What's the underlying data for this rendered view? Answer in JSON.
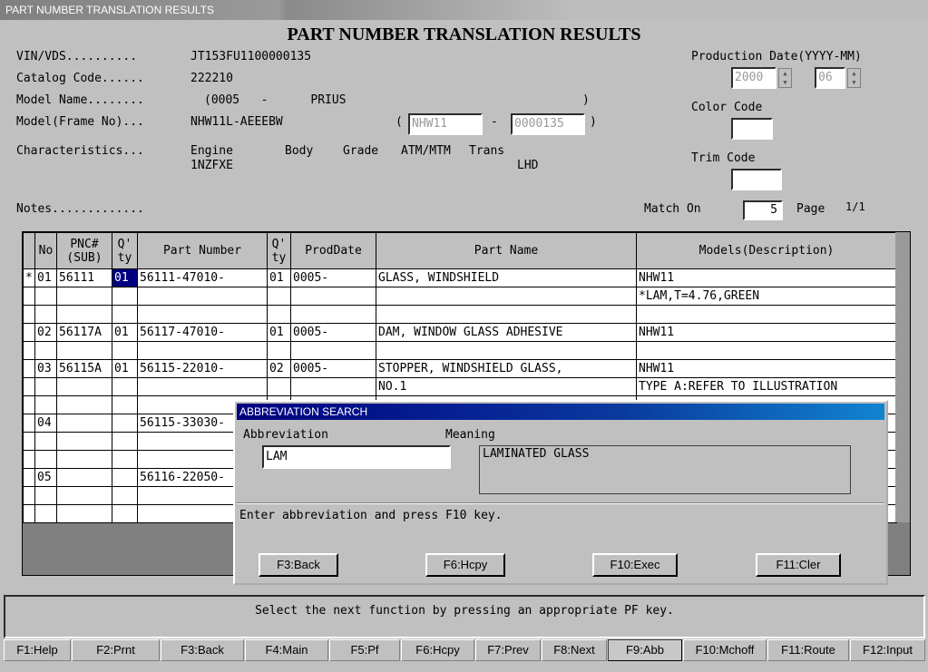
{
  "window": {
    "title": "PART NUMBER TRANSLATION RESULTS"
  },
  "page_title": "PART NUMBER TRANSLATION RESULTS",
  "info": {
    "vin_label": "VIN/VDS..........",
    "vin_value": "JT153FU1100000135",
    "catalog_label": "Catalog Code......",
    "catalog_value": "222210",
    "model_name_label": "Model Name........",
    "model_name_value": "(0005   -      PRIUS",
    "model_name_close": ")",
    "model_frame_label": "Model(Frame No)...",
    "model_frame_value": "NHW11L-AEEEBW",
    "frame_open": "(",
    "frame_dash": "-",
    "frame_close": ")",
    "frame_input_1": "NHW11",
    "frame_input_2": "0000135",
    "characteristics_label": "Characteristics...",
    "char_headers": [
      "Engine",
      "Body",
      "Grade",
      "ATM/MTM",
      "Trans"
    ],
    "char_engine": "1NZFXE",
    "char_trans": "LHD",
    "notes_label": "Notes.............",
    "production_date_label": "Production Date(YYYY-MM)",
    "prod_year": "2000",
    "prod_month": "06",
    "color_code_label": "Color Code",
    "trim_code_label": "Trim Code",
    "match_on_label": "Match On",
    "match_on_value": "5",
    "page_label": "Page",
    "page_value": "1/1"
  },
  "table": {
    "headers": [
      "No",
      "PNC#\n(SUB)",
      "Q'\nty",
      "Part Number",
      "Q'\nty",
      "ProdDate",
      "Part Name",
      "Models(Description)"
    ],
    "rows": [
      [
        "*",
        "01",
        "56111",
        "01",
        "56111-47010-",
        "01",
        "0005-",
        "GLASS, WINDSHIELD",
        "NHW11"
      ],
      [
        "",
        "",
        "",
        "",
        "",
        "",
        "",
        "",
        "*LAM,T=4.76,GREEN"
      ],
      [
        "",
        "",
        "",
        "",
        "",
        "",
        "",
        "",
        ""
      ],
      [
        "",
        "02",
        "56117A",
        "01",
        "56117-47010-",
        "01",
        "0005-",
        "DAM, WINDOW GLASS ADHESIVE",
        "NHW11"
      ],
      [
        "",
        "",
        "",
        "",
        "",
        "",
        "",
        "",
        ""
      ],
      [
        "",
        "03",
        "56115A",
        "01",
        "56115-22010-",
        "02",
        "0005-",
        "STOPPER, WINDSHIELD GLASS,",
        "NHW11"
      ],
      [
        "",
        "",
        "",
        "",
        "",
        "",
        "",
        "NO.1",
        "TYPE A:REFER TO ILLUSTRATION"
      ],
      [
        "",
        "",
        "",
        "",
        "",
        "",
        "",
        "",
        ""
      ],
      [
        "",
        "04",
        "",
        "",
        "56115-33030-",
        "",
        "",
        "",
        ""
      ],
      [
        "",
        "",
        "",
        "",
        "",
        "",
        "",
        "",
        ""
      ],
      [
        "",
        "",
        "",
        "",
        "",
        "",
        "",
        "",
        ""
      ],
      [
        "",
        "05",
        "",
        "",
        "56116-22050-",
        "",
        "",
        "",
        ""
      ],
      [
        "",
        "",
        "",
        "",
        "",
        "",
        "",
        "",
        ""
      ],
      [
        "",
        "",
        "",
        "",
        "",
        "",
        "",
        "",
        ""
      ]
    ]
  },
  "dialog": {
    "title": "ABBREVIATION SEARCH",
    "abbreviation_label": "Abbreviation",
    "abbreviation_value": "LAM",
    "meaning_label": "Meaning",
    "meaning_value": "LAMINATED GLASS",
    "instruction": "Enter abbreviation and press F10 key.",
    "buttons": [
      "F3:Back",
      "F6:Hcpy",
      "F10:Exec",
      "F11:Cler"
    ]
  },
  "status_message": "Select the next function by pressing an appropriate PF key.",
  "function_keys": [
    "F1:Help",
    "F2:Prnt",
    "F3:Back",
    "F4:Main",
    "F5:Pf",
    "F6:Hcpy",
    "F7:Prev",
    "F8:Next",
    "F9:Abb",
    "F10:Mchoff",
    "F11:Route",
    "F12:Input"
  ]
}
